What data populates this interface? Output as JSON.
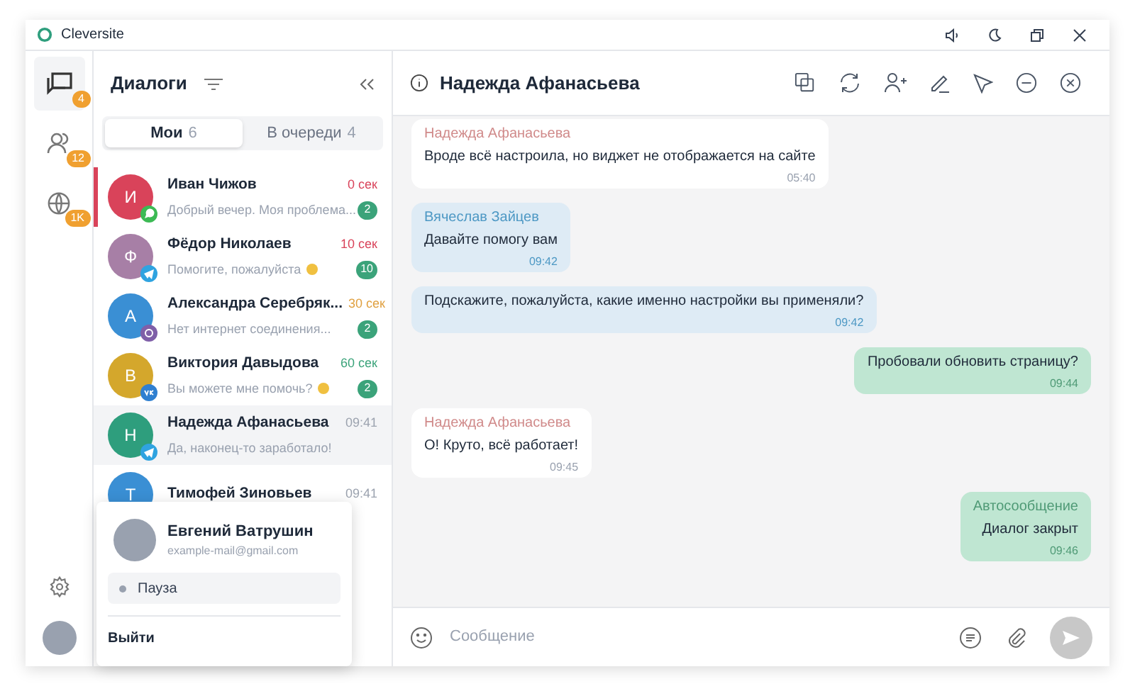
{
  "window": {
    "title": "Cleversite"
  },
  "rail": [
    {
      "kind": "chats",
      "badge": "4",
      "selected": true
    },
    {
      "kind": "users",
      "badge": "12",
      "selected": false
    },
    {
      "kind": "globe",
      "badge": "1K",
      "selected": false
    }
  ],
  "list": {
    "title": "Диалоги",
    "tabs": [
      {
        "label": "Мои",
        "count": "6",
        "selected": true
      },
      {
        "label": "В очереди",
        "count": "4",
        "selected": false
      }
    ],
    "items": [
      {
        "letter": "И",
        "color": "#d9435a",
        "kind": "whatsapp",
        "name": "Иван Чижов",
        "preview": "Добрый вечер. Моя проблема...",
        "emoji": false,
        "time": {
          "text": "0 сек",
          "color": "#d9435a"
        },
        "unread": "2",
        "active": true,
        "selected": false
      },
      {
        "letter": "Ф",
        "color": "#a77fa6",
        "kind": "telegram",
        "name": "Фёдор Николаев",
        "preview": "Помогите, пожалуйста",
        "emoji": true,
        "time": {
          "text": "10 сек",
          "color": "#d9435a"
        },
        "unread": "10",
        "active": false,
        "selected": false
      },
      {
        "letter": "А",
        "color": "#3a8fd4",
        "kind": "viber",
        "name": "Александра Серебряк...",
        "preview": "Нет интернет соединения...",
        "emoji": false,
        "time": {
          "text": "30 сек",
          "color": "#e0a040"
        },
        "unread": "2",
        "active": false,
        "selected": false
      },
      {
        "letter": "В",
        "color": "#d4a72c",
        "kind": "vk",
        "name": "Виктория Давыдова",
        "preview": "Вы можете мне помочь?",
        "emoji": true,
        "time": {
          "text": "60 сек",
          "color": "#3ba37a"
        },
        "unread": "2",
        "active": false,
        "selected": false
      },
      {
        "letter": "Н",
        "color": "#2e9e7d",
        "kind": "telegram",
        "name": "Надежда Афанасьева",
        "preview": "Да, наконец-то заработало!",
        "emoji": false,
        "time": {
          "text": "09:41",
          "color": "#9ca3af"
        },
        "active": false,
        "selected": true
      },
      {
        "letter": "Т",
        "color": "#3a8fd4",
        "name": "Тимофей Зиновьев",
        "time": {
          "text": "09:41",
          "color": "#9ca3af"
        },
        "active": false,
        "selected": false
      }
    ]
  },
  "profile_menu": {
    "name": "Евгений Ватрушин",
    "email": "example-mail@gmail.com",
    "status": "Пауза",
    "logout": "Выйти"
  },
  "chat": {
    "title": "Надежда Афанасьева",
    "messages": [
      {
        "kind": "client",
        "author": "Надежда Афанасьева",
        "text": "Вроде всё настроила, но виджет не отображается на сайте",
        "time": "05:40"
      },
      {
        "kind": "operator",
        "author": "Вячеслав Зайцев",
        "text": "Давайте помогу вам",
        "time": "09:42"
      },
      {
        "kind": "operator",
        "text": "Подскажите, пожалуйста, какие именно настройки вы применяли?",
        "time": "09:42"
      },
      {
        "kind": "auto",
        "text": "Пробовали обновить страницу?",
        "time": "09:44"
      },
      {
        "kind": "client",
        "author": "Надежда Афанасьева",
        "text": "О! Круто, всё работает!",
        "time": "09:45"
      },
      {
        "kind": "auto",
        "author": "Автосообщение",
        "text": "Диалог закрыт",
        "time": "09:46"
      }
    ],
    "composer": {
      "placeholder": "Сообщение"
    }
  }
}
